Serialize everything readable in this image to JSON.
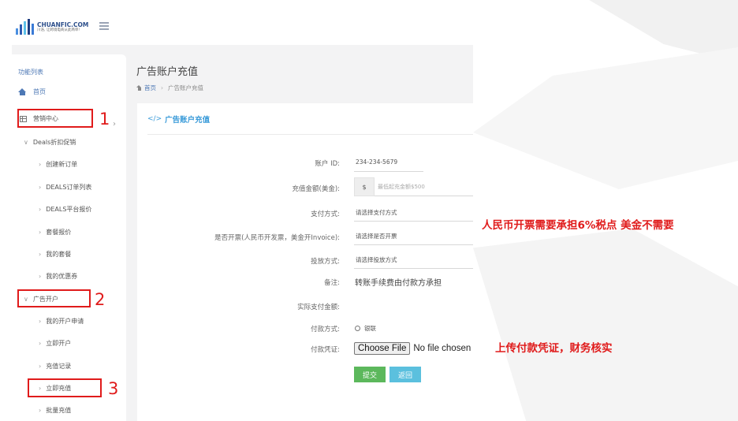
{
  "brand": {
    "name": "CHUANFIC.COM",
    "tagline": "川浩, 让跨境电商从此简单!",
    "bar_colors": [
      "#4a8fe0",
      "#2d5bb0",
      "#5dc1e8",
      "#1e3d80",
      "#3a7ad6"
    ]
  },
  "sidebar": {
    "title": "功能列表",
    "home": "首页",
    "marketing_center": "营销中心",
    "deals_group": "Deals折扣促销",
    "deals_items": [
      "创建新订单",
      "DEALS订单列表",
      "DEALS平台报价",
      "套餐报价",
      "我的套餐",
      "我的优惠券"
    ],
    "ad_group": "广告开户",
    "ad_items": [
      "我的开户申请",
      "立即开户",
      "充值记录",
      "立即充值",
      "批量充值"
    ]
  },
  "main": {
    "page_title": "广告账户充值",
    "breadcrumb_home": "首页",
    "breadcrumb_current": "广告账户充值",
    "card_title": "广告账户充值"
  },
  "form": {
    "account_id_label": "账户 ID:",
    "account_id_value": "234-234-5679",
    "amount_label": "充值金额(美金):",
    "currency_symbol": "$",
    "amount_placeholder": "最低起充金额$500",
    "payment_method_label": "支付方式:",
    "payment_method_value": "请选择支付方式",
    "invoice_label": "是否开票(人民币开发票，美金开Invoice):",
    "invoice_value": "请选择是否开票",
    "delivery_label": "投放方式:",
    "delivery_value": "请选择投放方式",
    "remark_label": "备注:",
    "remark_value": "转账手续费由付款方承担",
    "actual_amount_label": "实际支付金额:",
    "pay_type_label": "付款方式:",
    "pay_type_option": "银联",
    "voucher_label": "付款凭证:",
    "file_button": "Choose File",
    "file_status": "No file chosen",
    "submit": "提交",
    "back": "返回"
  },
  "annotations": {
    "num1": "1",
    "num2": "2",
    "num3": "3",
    "invoice_note": "人民币开票需要承担6%税点 美金不需要",
    "upload_note": "上传付款凭证，财务核实"
  },
  "colors": {
    "accent": "#4d78b5",
    "highlight_red": "#e01b1b",
    "submit_green": "#5cb85c",
    "back_cyan": "#5bc0de"
  }
}
